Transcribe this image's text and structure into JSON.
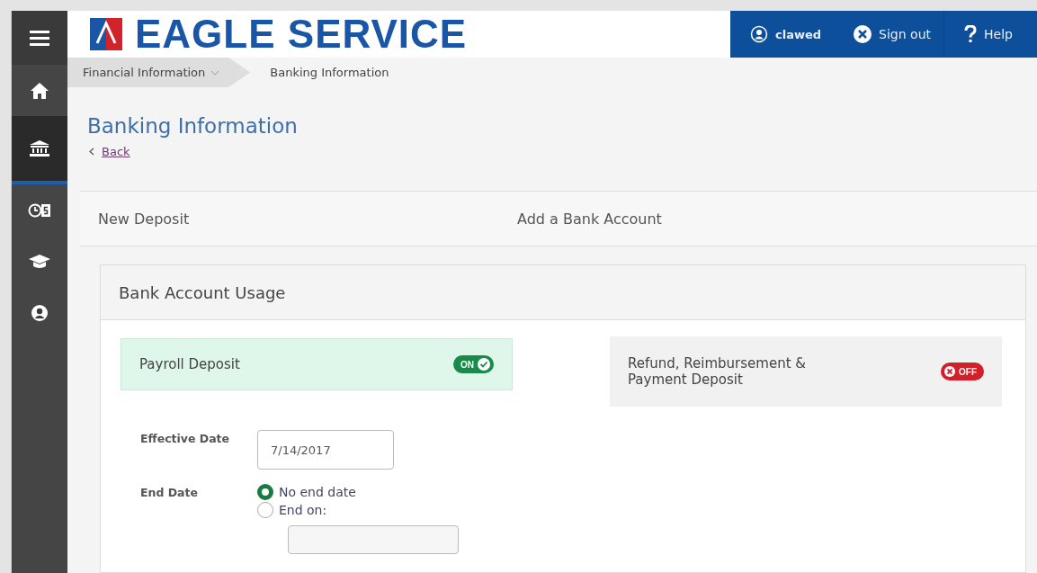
{
  "sidebar": {
    "items": [
      {
        "kind": "menu",
        "selected": false
      },
      {
        "kind": "home",
        "selected": false
      },
      {
        "kind": "bank",
        "selected": true
      },
      {
        "kind": "clock-dollar",
        "selected": false
      },
      {
        "kind": "cap",
        "selected": false
      },
      {
        "kind": "user",
        "selected": false
      }
    ]
  },
  "header": {
    "title": "EAGLE SERVICE",
    "user": "clawed",
    "sign_out": "Sign out",
    "help": "Help"
  },
  "breadcrumbs": [
    {
      "label": "Financial Information",
      "dropdown": true
    },
    {
      "label": "Banking Information",
      "dropdown": false
    }
  ],
  "page": {
    "title": "Banking Information",
    "back": "Back"
  },
  "tabs": [
    {
      "label": "New Deposit"
    },
    {
      "label": "Add a Bank Account"
    }
  ],
  "card": {
    "title": "Bank Account Usage",
    "deposits": [
      {
        "label": "Payroll Deposit",
        "on": true,
        "toggle": "ON"
      },
      {
        "label": "Refund, Reimbursement & Payment Deposit",
        "on": false,
        "toggle": "OFF"
      }
    ],
    "effective_date": {
      "label": "Effective Date",
      "value": "7/14/2017"
    },
    "end_date": {
      "label": "End Date",
      "options": [
        {
          "label": "No end date",
          "selected": true
        },
        {
          "label": "End on:",
          "selected": false
        }
      ]
    }
  }
}
